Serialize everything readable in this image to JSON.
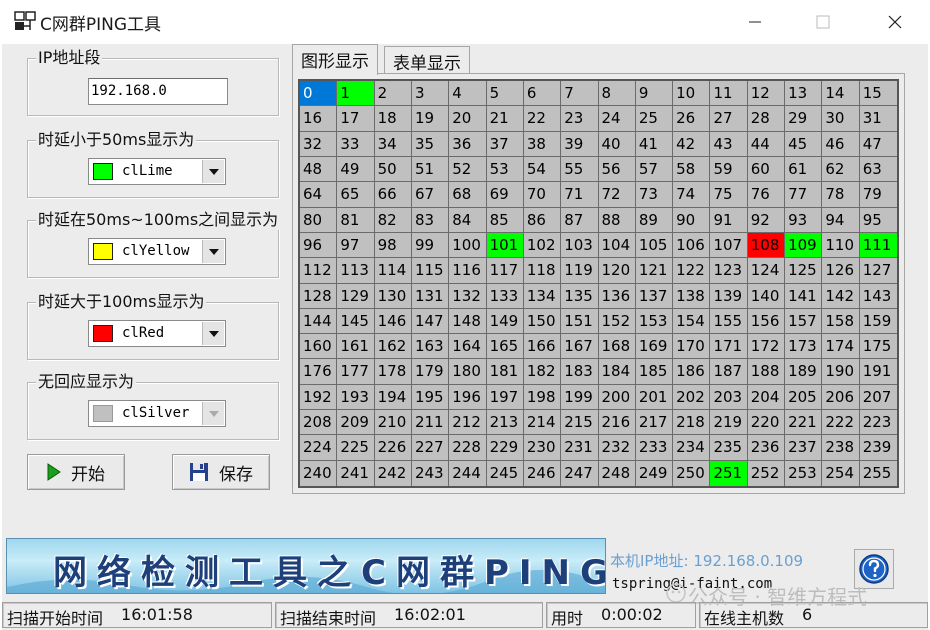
{
  "window": {
    "title": "C网群PING工具"
  },
  "ip_group": {
    "label": "IP地址段",
    "value": "192.168.0"
  },
  "fast_group": {
    "label": "时延小于50ms显示为",
    "color_name": "clLime",
    "color": "#00ff00"
  },
  "mid_group": {
    "label": "时延在50ms~100ms之间显示为",
    "color_name": "clYellow",
    "color": "#ffff00"
  },
  "slow_group": {
    "label": "时延大于100ms显示为",
    "color_name": "clRed",
    "color": "#ff0000"
  },
  "none_group": {
    "label": "无回应显示为",
    "color_name": "clSilver",
    "color": "#c0c0c0"
  },
  "buttons": {
    "start": "开始",
    "save": "保存"
  },
  "tabs": [
    {
      "label": "图形显示"
    },
    {
      "label": "表单显示"
    }
  ],
  "grid": {
    "count": 256,
    "selected": 0,
    "lime_hosts": [
      1,
      101,
      109,
      111,
      251
    ],
    "red_hosts": [
      108
    ]
  },
  "banner": {
    "text": "网络检测工具之C网群PING"
  },
  "info": {
    "ip_label": "本机IP地址:",
    "ip_value": "192.168.0.109",
    "email": "tspring@i-faint.com"
  },
  "watermark": "公众号 · 智维方程式",
  "status": {
    "start_label": "扫描开始时间",
    "start_value": "16:01:58",
    "end_label": "扫描结束时间",
    "end_value": "16:02:01",
    "elapsed_label": "用时",
    "elapsed_value": "0:00:02",
    "hosts_label": "在线主机数",
    "hosts_value": "6"
  }
}
